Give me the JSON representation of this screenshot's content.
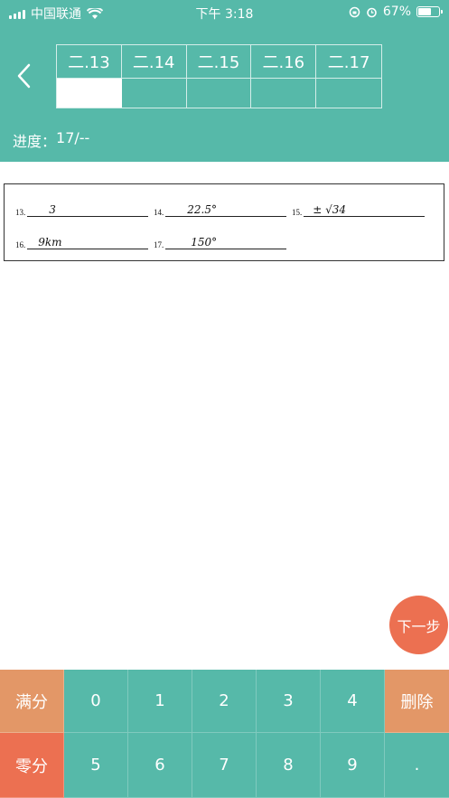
{
  "status_bar": {
    "carrier": "中国联通",
    "time": "下午 3:18",
    "battery_percent": "67%",
    "battery_level": 0.67
  },
  "header": {
    "question_tabs": [
      "二.13",
      "二.14",
      "二.15",
      "二.16",
      "二.17"
    ],
    "progress_label": "进度：",
    "progress_value": "17/--"
  },
  "answer_sheet": {
    "questions": [
      {
        "num": "13.",
        "answer": "3"
      },
      {
        "num": "14.",
        "answer": "22.5°"
      },
      {
        "num": "15.",
        "answer": "± √34"
      },
      {
        "num": "16.",
        "answer": "9km"
      },
      {
        "num": "17.",
        "answer": "150°"
      }
    ]
  },
  "next_button": "下一步",
  "keypad": {
    "full_score": "满分",
    "zero_score": "零分",
    "delete": "删除",
    "digits_row1": [
      "0",
      "1",
      "2",
      "3",
      "4"
    ],
    "digits_row2": [
      "5",
      "6",
      "7",
      "8",
      "9"
    ],
    "dot": "."
  },
  "colors": {
    "primary": "#56b9a9",
    "accent_orange": "#e39767",
    "accent_red": "#ec7051"
  }
}
